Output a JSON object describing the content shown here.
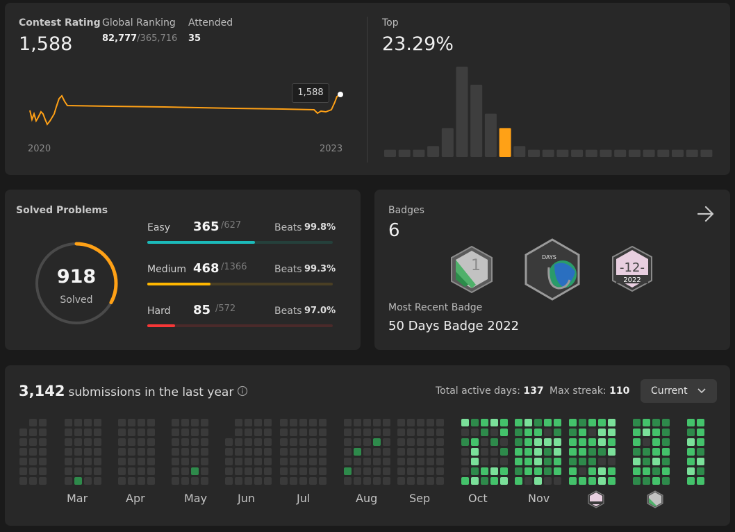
{
  "contest": {
    "rating_label": "Contest Rating",
    "rating": "1,588",
    "global_label": "Global Ranking",
    "global_rank": "82,777",
    "global_total": "/365,716",
    "attended_label": "Attended",
    "attended": "35",
    "tooltip": "1,588",
    "x_start": "2020",
    "x_end": "2023"
  },
  "top": {
    "label": "Top",
    "value": "23.29%",
    "histogram": [
      2,
      2,
      2,
      3,
      8,
      25,
      20,
      12,
      8,
      3,
      2,
      2,
      2,
      2,
      2,
      2,
      2,
      2,
      2,
      2,
      2,
      2,
      2
    ],
    "highlight_index": 8,
    "colors": {
      "bar": "#3e3e3e",
      "highlight": "#ffa116"
    }
  },
  "solved": {
    "title": "Solved Problems",
    "total": "918",
    "total_label": "Solved",
    "items": [
      {
        "name": "Easy",
        "count": "365",
        "total": "/627",
        "beats_label": "Beats",
        "beats": "99.8%",
        "progress": 0.58,
        "color": "#1cbaba",
        "track": "#25403b"
      },
      {
        "name": "Medium",
        "count": "468",
        "total": "/1366",
        "beats_label": "Beats",
        "beats": "99.3%",
        "progress": 0.34,
        "color": "#ffb700",
        "track": "#4a3f24"
      },
      {
        "name": "Hard",
        "count": "85",
        "total": "/572",
        "beats_label": "Beats",
        "beats": "97.0%",
        "progress": 0.15,
        "color": "#f63737",
        "track": "#4a2a2a"
      }
    ]
  },
  "badges": {
    "title": "Badges",
    "count": "6",
    "recent_label": "Most Recent Badge",
    "recent_name": "50 Days Badge 2022",
    "badge1_text": "1",
    "badge2_text": "DAYS",
    "badge3_text": "-12-",
    "badge3_year": "2022"
  },
  "submissions": {
    "count": "3,142",
    "label": "submissions in the last year",
    "active_label": "Total active days:",
    "active": "137",
    "streak_label": "Max streak:",
    "streak": "110",
    "dropdown": "Current",
    "months": [
      "Mar",
      "Apr",
      "May",
      "Jun",
      "Jul",
      "Aug",
      "Sep",
      "Oct",
      "Nov"
    ],
    "colors": {
      "empty": "#3a3a3a",
      "l1": "#1e5c33",
      "l2": "#2e8a4b",
      "l3": "#44c26b",
      "l4": "#7be09a"
    }
  }
}
